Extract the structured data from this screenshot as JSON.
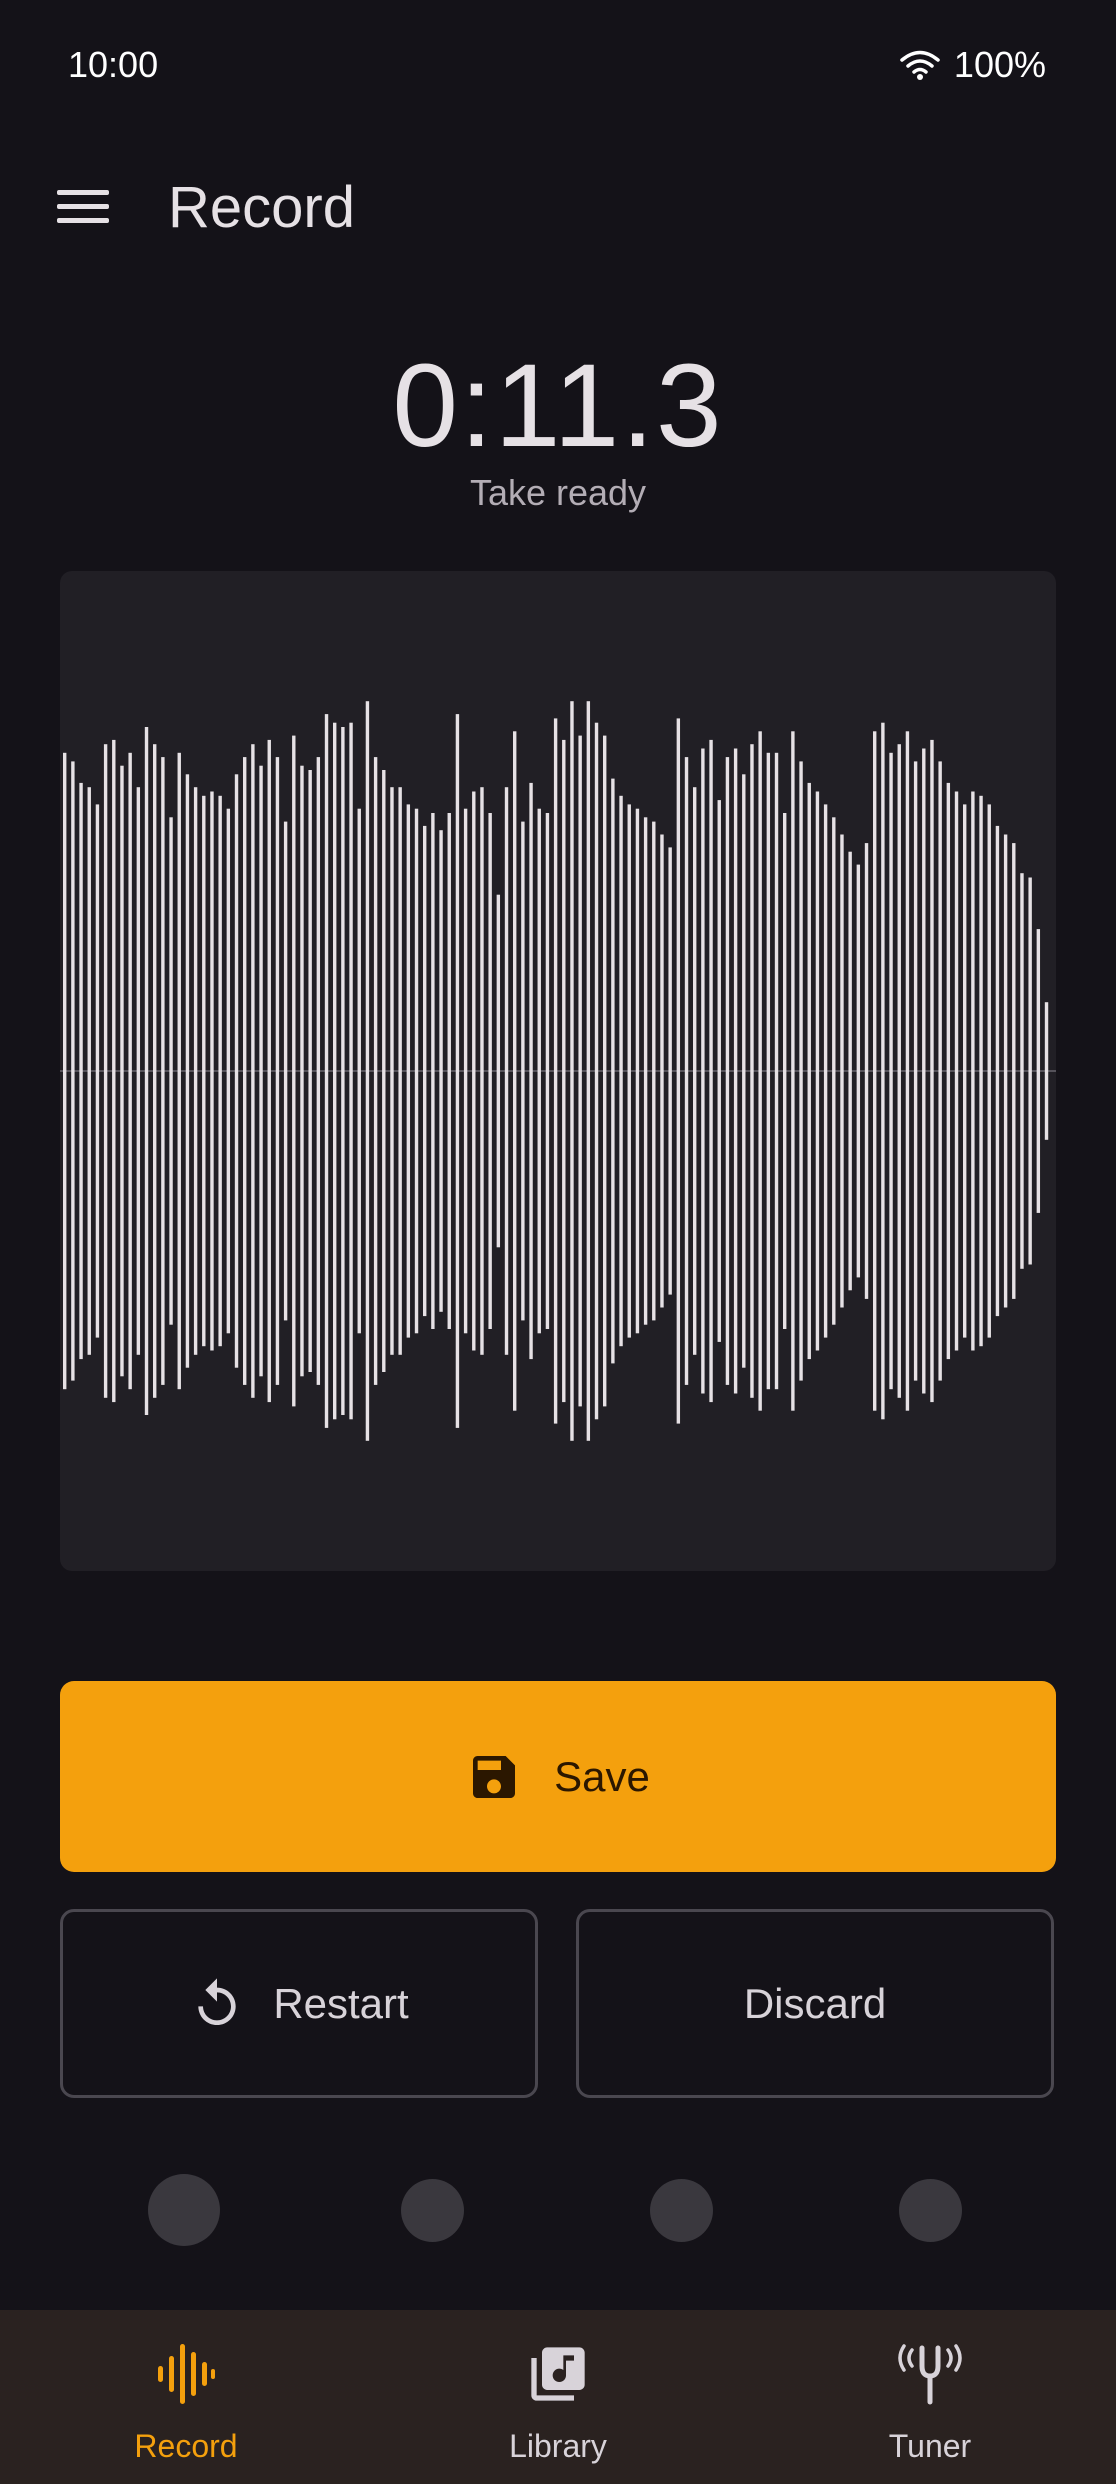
{
  "status_bar": {
    "time": "10:00",
    "battery": "100%",
    "wifi_icon": "wifi-icon"
  },
  "app_bar": {
    "title": "Record",
    "menu_icon": "menu-icon"
  },
  "recording": {
    "timer": "0:11.3",
    "status": "Take ready",
    "waveform_amplitudes": [
      0.74,
      0.72,
      0.67,
      0.66,
      0.62,
      0.76,
      0.77,
      0.71,
      0.74,
      0.66,
      0.8,
      0.76,
      0.73,
      0.59,
      0.74,
      0.69,
      0.66,
      0.64,
      0.65,
      0.64,
      0.61,
      0.69,
      0.73,
      0.76,
      0.71,
      0.77,
      0.73,
      0.58,
      0.78,
      0.71,
      0.7,
      0.73,
      0.83,
      0.81,
      0.8,
      0.81,
      0.61,
      0.86,
      0.73,
      0.7,
      0.66,
      0.66,
      0.62,
      0.61,
      0.57,
      0.6,
      0.56,
      0.6,
      0.83,
      0.61,
      0.65,
      0.66,
      0.6,
      0.41,
      0.66,
      0.79,
      0.58,
      0.67,
      0.61,
      0.6,
      0.82,
      0.77,
      0.86,
      0.78,
      0.86,
      0.81,
      0.78,
      0.68,
      0.64,
      0.62,
      0.61,
      0.59,
      0.58,
      0.55,
      0.52,
      0.82,
      0.73,
      0.66,
      0.75,
      0.77,
      0.63,
      0.73,
      0.75,
      0.69,
      0.76,
      0.79,
      0.74,
      0.74,
      0.6,
      0.79,
      0.72,
      0.67,
      0.65,
      0.62,
      0.59,
      0.55,
      0.51,
      0.48,
      0.53,
      0.79,
      0.81,
      0.74,
      0.76,
      0.79,
      0.72,
      0.75,
      0.77,
      0.72,
      0.67,
      0.65,
      0.62,
      0.65,
      0.64,
      0.62,
      0.57,
      0.55,
      0.53,
      0.46,
      0.45,
      0.33,
      0.16
    ],
    "waveform_base_color": "#e6e1e5"
  },
  "actions": {
    "save_label": "Save",
    "save_icon": "floppy-disk-icon",
    "restart_label": "Restart",
    "restart_icon": "restart-icon",
    "discard_label": "Discard",
    "accent_color": "#f4a00d"
  },
  "nav": {
    "items": [
      {
        "label": "Record",
        "icon": "waveform-icon",
        "active": true
      },
      {
        "label": "Library",
        "icon": "music-library-icon",
        "active": false
      },
      {
        "label": "Tuner",
        "icon": "tuning-fork-icon",
        "active": false
      }
    ]
  }
}
